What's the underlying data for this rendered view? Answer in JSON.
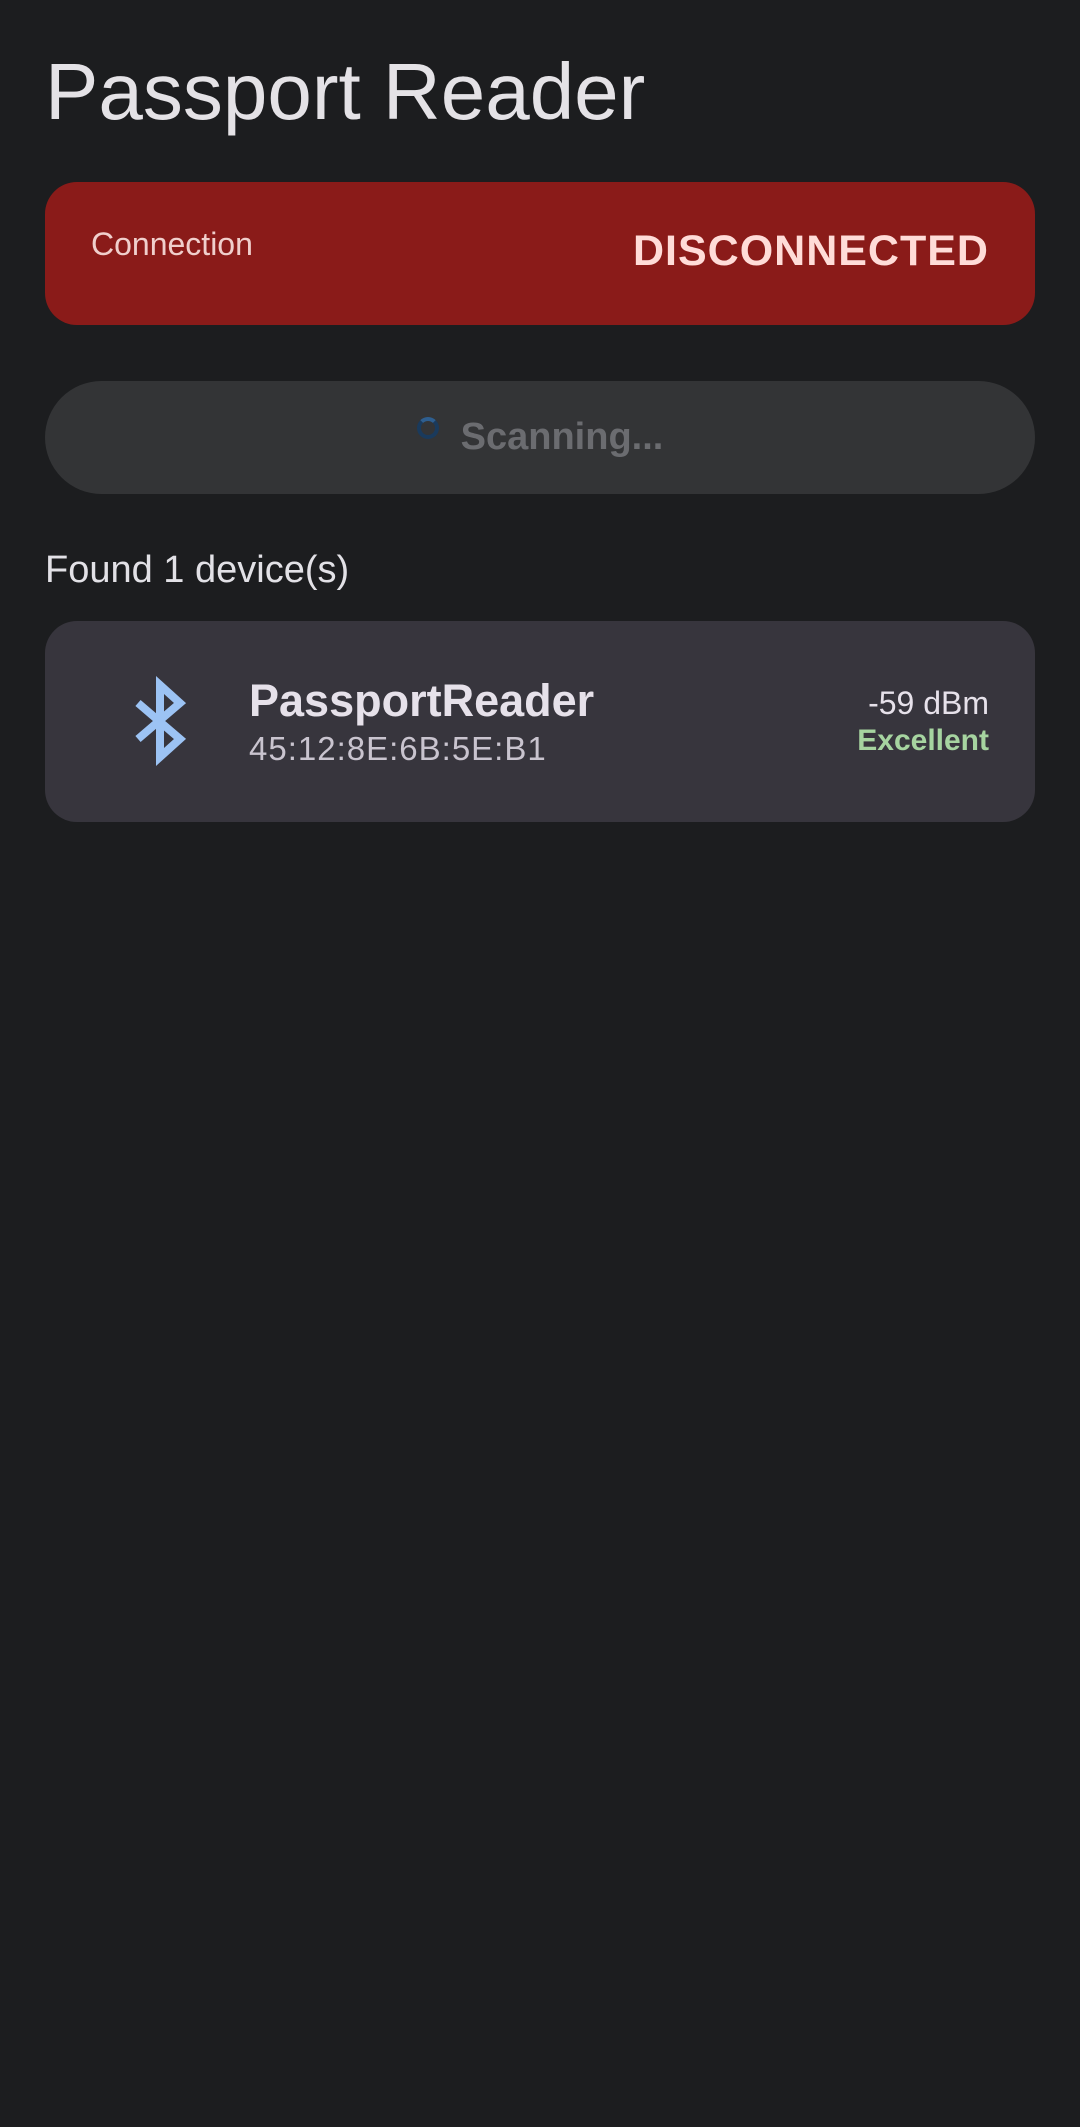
{
  "header": {
    "title": "Passport Reader"
  },
  "connection": {
    "label": "Connection",
    "status": "DISCONNECTED",
    "status_color": "#8a1b19"
  },
  "scan": {
    "label": "Scanning...",
    "spinner_icon": "progress-spinner-icon"
  },
  "devices": {
    "found_label": "Found 1 device(s)",
    "items": [
      {
        "icon": "bluetooth-icon",
        "name": "PassportReader",
        "mac": "45:12:8E:6B:5E:B1",
        "rssi": "-59 dBm",
        "quality": "Excellent",
        "quality_color": "#a6d4a0"
      }
    ]
  }
}
